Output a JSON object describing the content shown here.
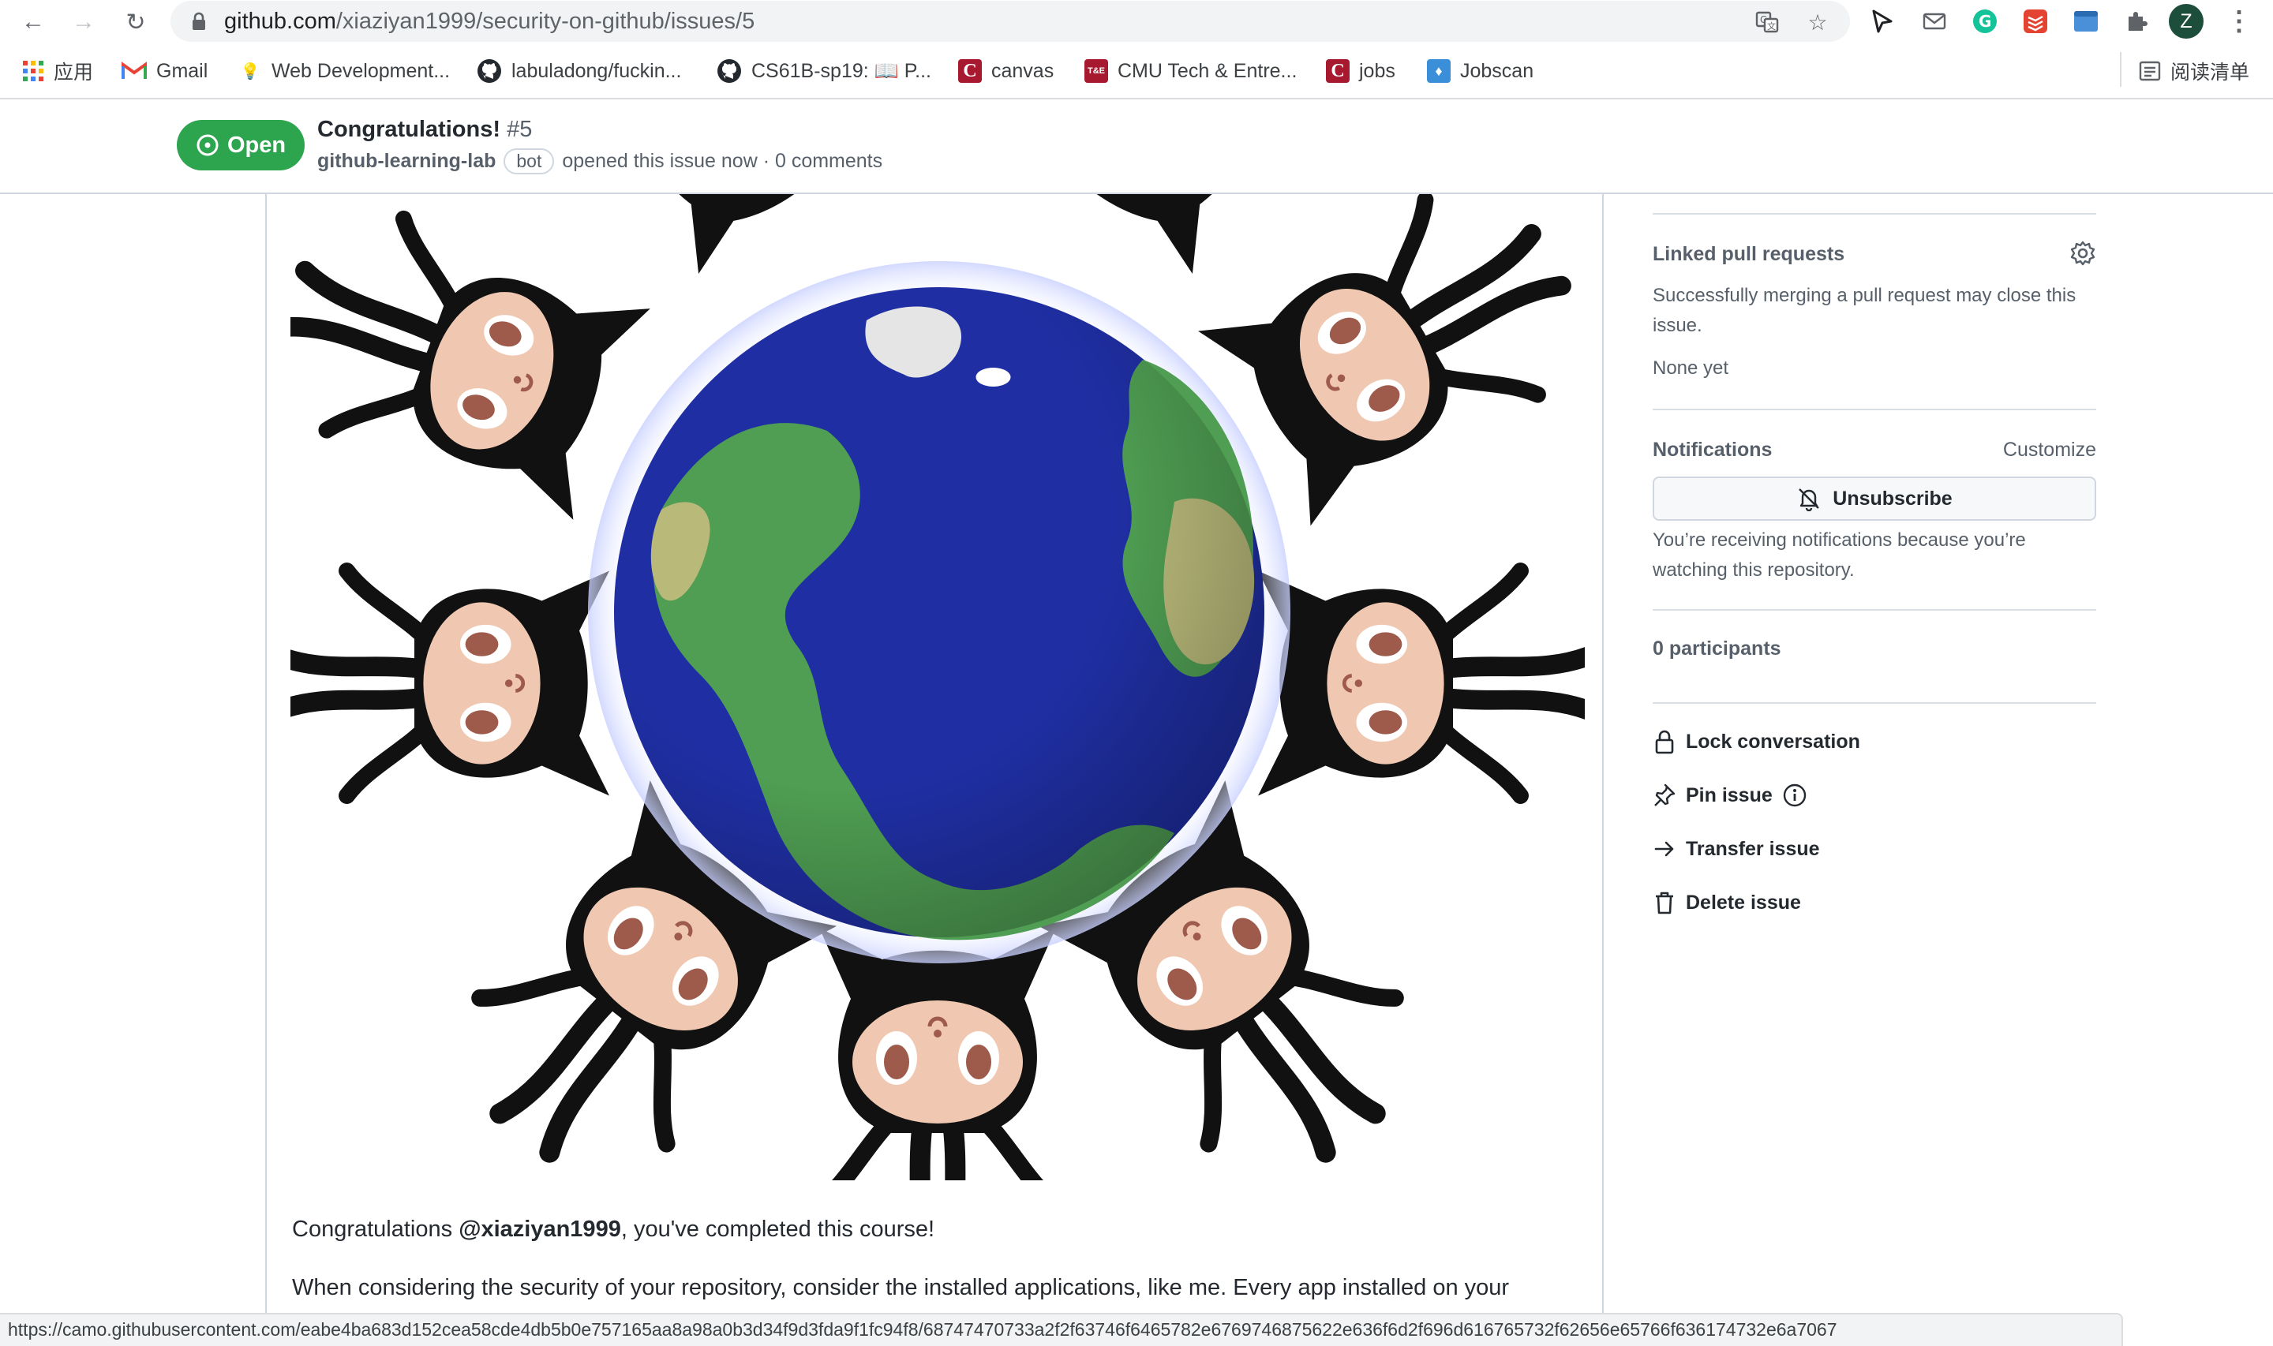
{
  "browser": {
    "url_host": "github.com",
    "url_path": "/xiaziyan1999/security-on-github/issues/5",
    "profile_initial": "Z",
    "bookmarks": [
      {
        "label": "应用"
      },
      {
        "label": "Gmail"
      },
      {
        "label": "Web Development..."
      },
      {
        "label": "labuladong/fuckin..."
      },
      {
        "label": "CS61B-sp19: 📖 P..."
      },
      {
        "label": "canvas"
      },
      {
        "label": "CMU Tech & Entre..."
      },
      {
        "label": "jobs"
      },
      {
        "label": "Jobscan"
      }
    ],
    "reading_list": "阅读清单",
    "status_url": "https://camo.githubusercontent.com/eabe4ba683d152cea58cde4db5b0e757165aa8a98a0b3d34f9d3fda9f1fc94f8/68747470733a2f2f63746f6465782e6769746875622e636f6d2f696d616765732f62656e65766f636174732e6a7067"
  },
  "issue": {
    "state": "Open",
    "title": "Congratulations!",
    "number": "#5",
    "author": "github-learning-lab",
    "author_badge": "bot",
    "meta": "opened this issue now · 0 comments"
  },
  "comment": {
    "line1_prefix": "Congratulations ",
    "mention": "@xiaziyan1999",
    "line1_suffix": ", you've completed this course!",
    "line2": "When considering the security of your repository, consider the installed applications, like me. Every app installed on your"
  },
  "sidebar": {
    "linked_pr_heading": "Linked pull requests",
    "linked_pr_desc": "Successfully merging a pull request may close this issue.",
    "linked_pr_value": "None yet",
    "notifications_heading": "Notifications",
    "customize_link": "Customize",
    "unsubscribe_label": "Unsubscribe",
    "notifications_reason": "You’re receiving notifications because you’re watching this repository.",
    "participants": "0 participants",
    "actions": {
      "lock": "Lock conversation",
      "pin": "Pin issue",
      "transfer": "Transfer issue",
      "delete": "Delete issue"
    }
  },
  "colors": {
    "open_green": "#2da44e",
    "ocean": "#1f2fa3",
    "land": "#4f9e53",
    "desert": "#b9b97a",
    "octocat_black": "#111111",
    "octocat_face": "#f0c8b1"
  }
}
